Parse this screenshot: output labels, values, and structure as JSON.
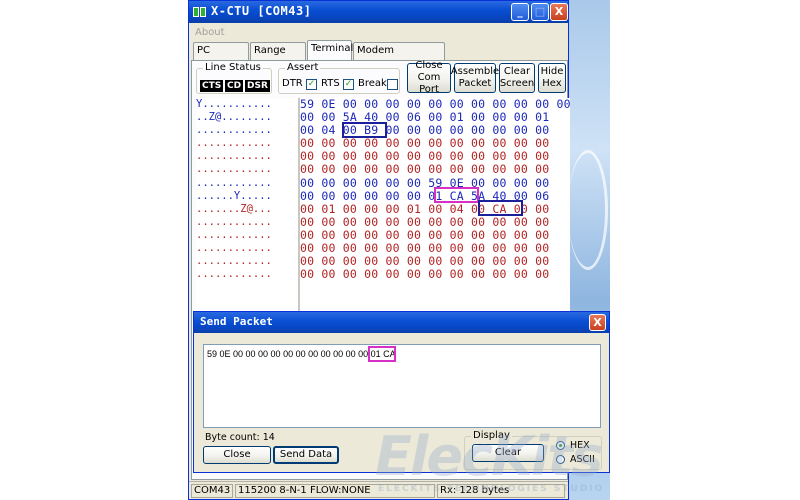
{
  "window": {
    "title": "X-CTU [COM43]",
    "minimize": "_",
    "maximize": "□",
    "close": "X"
  },
  "menu": {
    "about": "About"
  },
  "tabs": [
    {
      "label": "PC Settings"
    },
    {
      "label": "Range Test"
    },
    {
      "label": "Terminal"
    },
    {
      "label": "Modem Configuration"
    }
  ],
  "line_status": {
    "legend": "Line Status",
    "cts": "CTS",
    "cd": "CD",
    "dsr": "DSR"
  },
  "assert": {
    "legend": "Assert",
    "dtr": "DTR",
    "rts": "RTS",
    "break": "Break",
    "dtr_checked": "✓",
    "rts_checked": "✓"
  },
  "buttons": {
    "close_com_port_1": "Close",
    "close_com_port_2": "Com Port",
    "assemble_packet_1": "Assemble",
    "assemble_packet_2": "Packet",
    "clear_screen_1": "Clear",
    "clear_screen_2": "Screen",
    "hide_hex_1": "Hide",
    "hide_hex_2": "Hex"
  },
  "terminal": {
    "ascii_rows": [
      "Y...........",
      "..Z@........",
      "............",
      "............",
      "............",
      "............",
      "............",
      "......Y.....",
      ".......Z@...",
      "............",
      "............",
      "............",
      "............",
      "............"
    ],
    "hex_rows": [
      "59 0E 00 00 00 00 00 00 00 00 00 00 00",
      "00 00 5A 40 00 06 00 01 00 00 00 01",
      "00 04 00 B9 00 00 00 00 00 00 00 00",
      "00 00 00 00 00 00 00 00 00 00 00 00",
      "00 00 00 00 00 00 00 00 00 00 00 00",
      "00 00 00 00 00 00 00 00 00 00 00 00",
      "00 00 00 00 00 00 59 0E 00 00 00 00",
      "00 00 00 00 00 00 01 CA 5A 40 00 06",
      "00 01 00 00 00 01 00 04 00 CA 00 00",
      "00 00 00 00 00 00 00 00 00 00 00 00",
      "00 00 00 00 00 00 00 00 00 00 00 00",
      "00 00 00 00 00 00 00 00 00 00 00 00",
      "00 00 00 00 00 00 00 00 00 00 00 00",
      "00 00 00 00 00 00 00 00 00 00 00 00"
    ]
  },
  "statusbar": {
    "port": "COM43",
    "settings": "115200 8-N-1  FLOW:NONE",
    "rx": "Rx: 128 bytes"
  },
  "send_packet": {
    "title": "Send Packet",
    "close": "X",
    "content": "59 0E 00 00 00 00 00 00 00 00 00 00 00 01 CA",
    "byte_count": "Byte count: 14",
    "display_legend": "Display",
    "hex": "HEX",
    "ascii": "ASCII",
    "close_button": "Close",
    "send_data_button": "Send Data",
    "clear_button": "Clear"
  },
  "watermark": {
    "logo": "ElecKits",
    "subtitle": "ELECKITS TECHNOLOGIES STUDIO"
  },
  "colors": {
    "title_bar": "#0a4fd3",
    "hex_blue": "#1b27b8",
    "hex_red": "#b22323",
    "highlight_blue": "#1b1f9a",
    "highlight_magenta": "#d630c6"
  }
}
